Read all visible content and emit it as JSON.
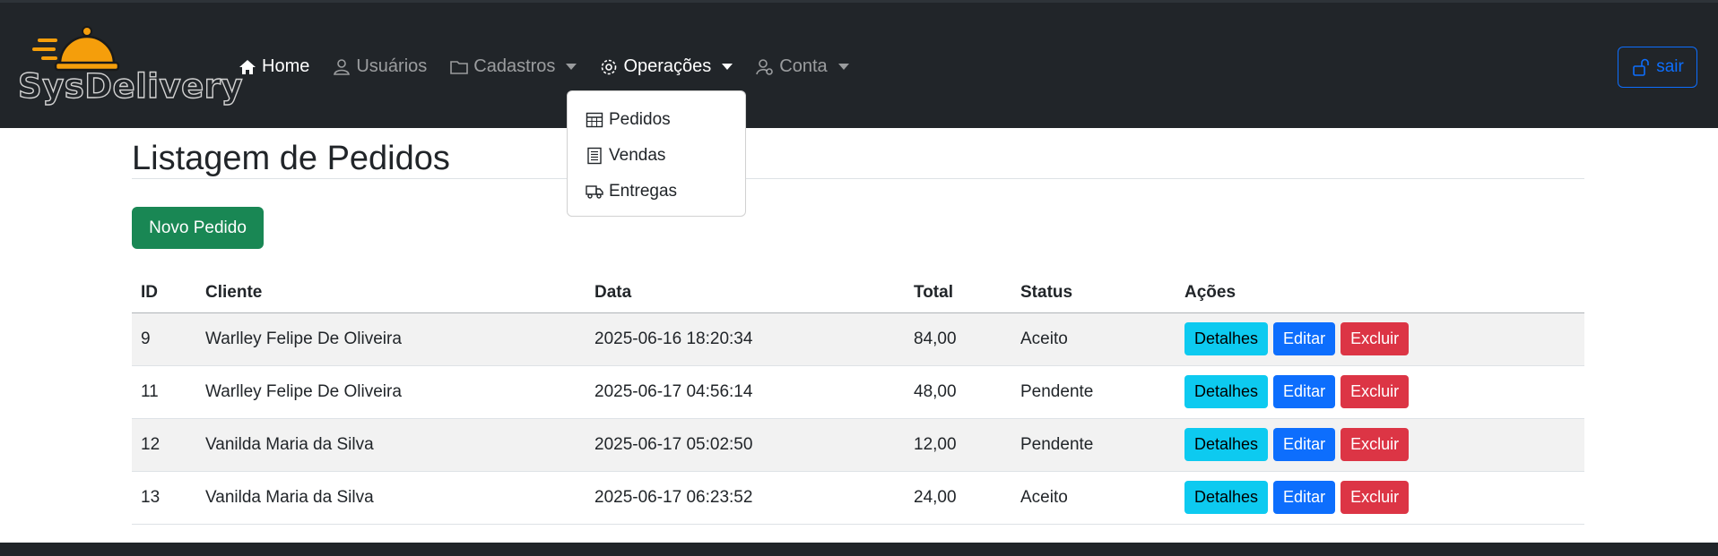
{
  "brand": {
    "name": "SysDelivery",
    "accent": "#f59e0b"
  },
  "nav": {
    "home": "Home",
    "users": "Usuários",
    "registrations": "Cadastros",
    "operations": "Operações",
    "account": "Conta"
  },
  "logout_label": "sair",
  "dropdown": {
    "items": [
      {
        "label": "Pedidos",
        "icon": "table-icon"
      },
      {
        "label": "Vendas",
        "icon": "receipt-icon"
      },
      {
        "label": "Entregas",
        "icon": "truck-icon"
      }
    ]
  },
  "page": {
    "title": "Listagem de Pedidos",
    "new_button": "Novo Pedido"
  },
  "table": {
    "headers": [
      "ID",
      "Cliente",
      "Data",
      "Total",
      "Status",
      "Ações"
    ],
    "rows": [
      {
        "id": "9",
        "client": "Warlley Felipe De Oliveira",
        "date": "2025-06-16 18:20:34",
        "total": "84,00",
        "status": "Aceito"
      },
      {
        "id": "11",
        "client": "Warlley Felipe De Oliveira",
        "date": "2025-06-17 04:56:14",
        "total": "48,00",
        "status": "Pendente"
      },
      {
        "id": "12",
        "client": "Vanilda Maria da Silva",
        "date": "2025-06-17 05:02:50",
        "total": "12,00",
        "status": "Pendente"
      },
      {
        "id": "13",
        "client": "Vanilda Maria da Silva",
        "date": "2025-06-17 06:23:52",
        "total": "24,00",
        "status": "Aceito"
      }
    ],
    "actions": {
      "details": "Detalhes",
      "edit": "Editar",
      "delete": "Excluir"
    }
  }
}
